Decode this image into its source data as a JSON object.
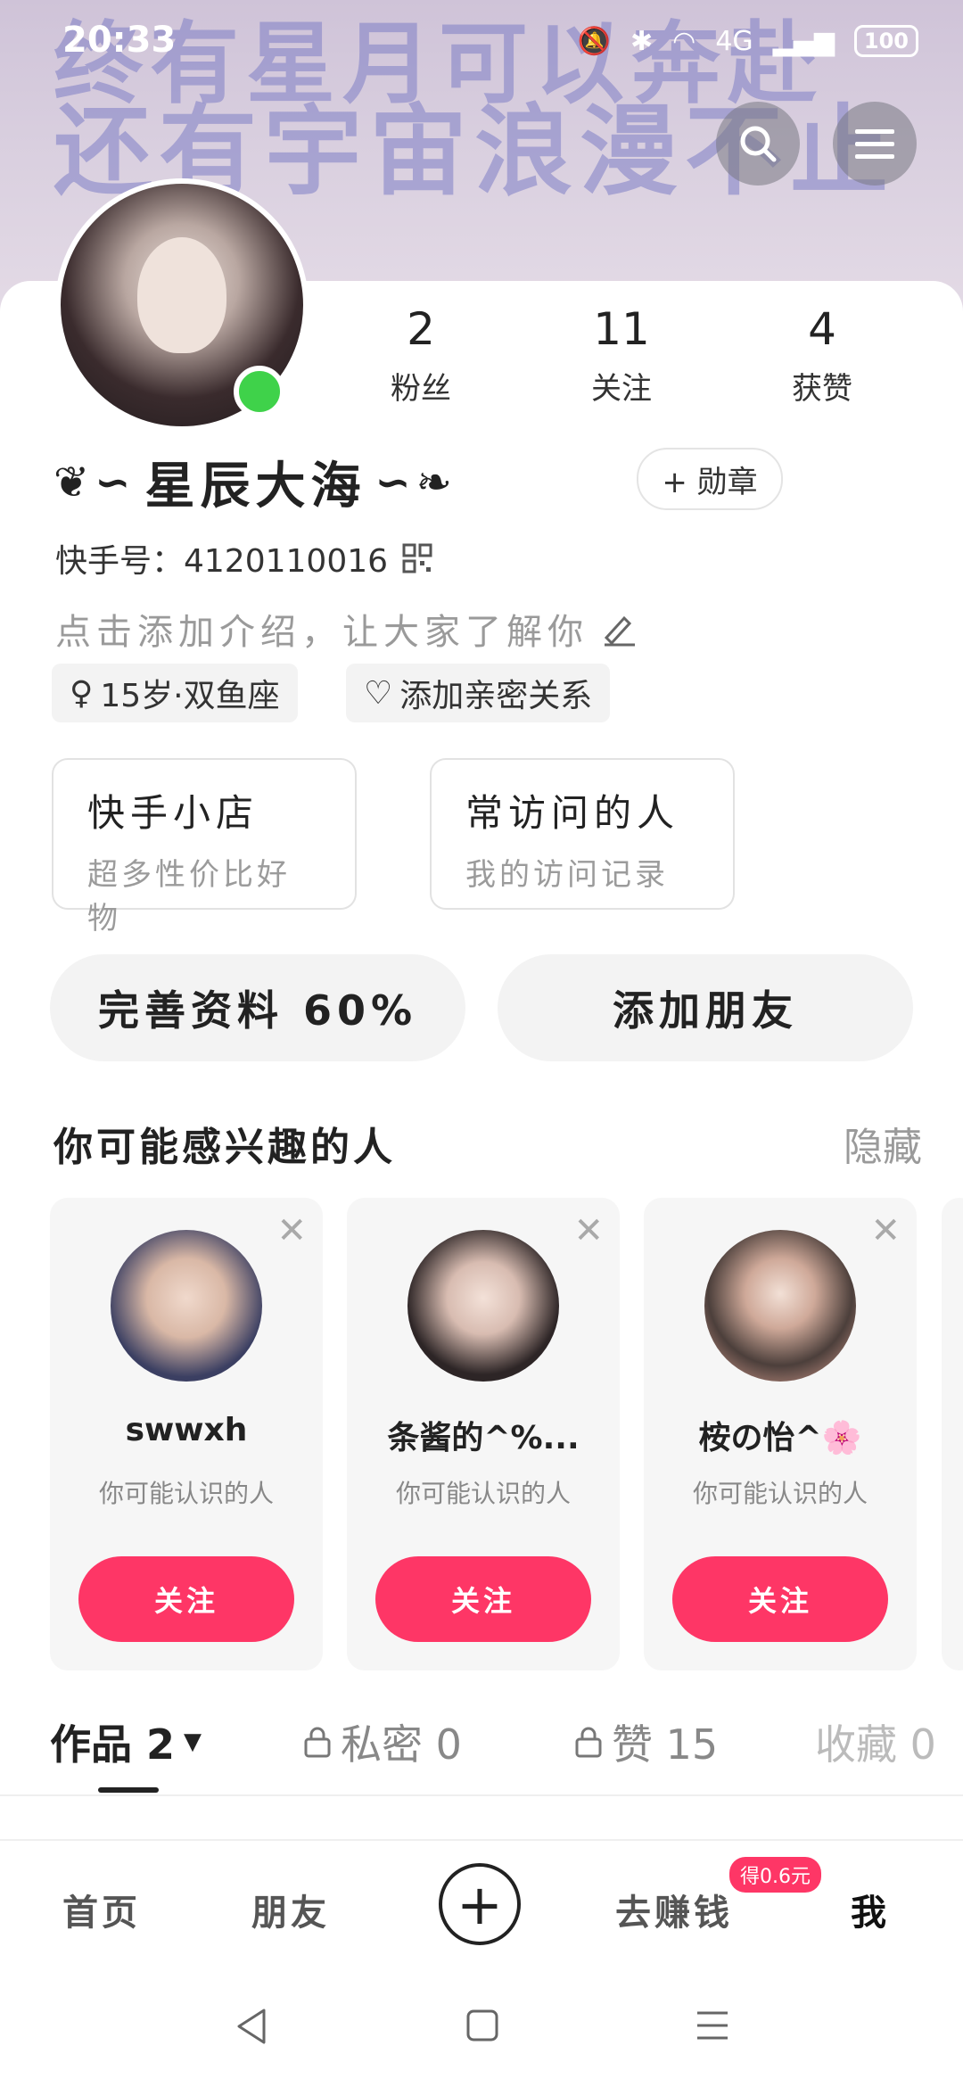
{
  "status_bar": {
    "time": "20:33",
    "network": "4G",
    "battery": "100"
  },
  "banner": {
    "line1": "还有宇宙浪漫不止",
    "line2": "终有星月可以奔赴"
  },
  "header": {
    "search_icon": "search-icon",
    "menu_icon": "menu-icon"
  },
  "stats": [
    {
      "value": "2",
      "label": "粉丝"
    },
    {
      "value": "11",
      "label": "关注"
    },
    {
      "value": "4",
      "label": "获赞"
    }
  ],
  "profile": {
    "nickname": "星辰大海",
    "badge_button": "+ 勋章",
    "kuaishou_id": "快手号：4120110016",
    "intro_placeholder": "点击添加介绍，让大家了解你",
    "chips": [
      "15岁·双鱼座",
      "添加亲密关系"
    ]
  },
  "features": [
    {
      "title": "快手小店",
      "subtitle": "超多性价比好物"
    },
    {
      "title": "常访问的人",
      "subtitle": "我的访问记录"
    }
  ],
  "actions": {
    "complete_profile": "完善资料 60%",
    "add_friend": "添加朋友"
  },
  "recommend": {
    "title": "你可能感兴趣的人",
    "hide": "隐藏",
    "cards": [
      {
        "name": "swwxh",
        "desc": "你可能认识的人",
        "follow": "关注",
        "avatar_color": "#3b3f62"
      },
      {
        "name": "条酱的^%...",
        "desc": "你可能认识的人",
        "follow": "关注",
        "avatar_color": "#8c7c78"
      },
      {
        "name": "桉の怡^🌸",
        "desc": "你可能认识的人",
        "follow": "关注",
        "avatar_color": "#4c3f3b"
      }
    ]
  },
  "tabs": [
    {
      "label": "作品 2"
    },
    {
      "label": "私密 0"
    },
    {
      "label": "赞 15"
    },
    {
      "label": "收藏 0"
    }
  ],
  "bottom_nav": {
    "home": "首页",
    "friends": "朋友",
    "earn": "去赚钱",
    "earn_badge": "得0.6元",
    "me": "我"
  },
  "colors": {
    "accent": "#fe3666",
    "online": "#3fd24a"
  }
}
